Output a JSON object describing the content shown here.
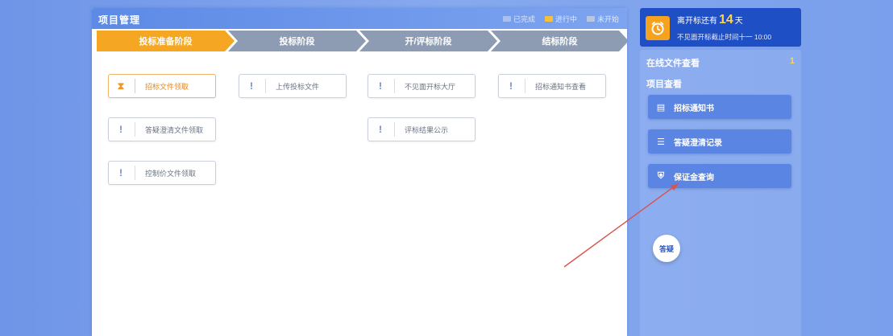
{
  "header": {
    "title": "项目管理",
    "legend": [
      {
        "label": "已完成",
        "color": "#a9c1f2"
      },
      {
        "label": "进行中",
        "color": "#f5c03a"
      },
      {
        "label": "未开始",
        "color": "#b9c6de"
      }
    ]
  },
  "steps": [
    {
      "label": "投标准备阶段",
      "state": "active"
    },
    {
      "label": "投标阶段",
      "state": "inactive"
    },
    {
      "label": "开/评标阶段",
      "state": "inactive"
    },
    {
      "label": "结标阶段",
      "state": "inactive"
    }
  ],
  "tasks": [
    {
      "label": "招标文件领取",
      "status": "done",
      "icon": "hourglass-icon",
      "glyph": "⧗"
    },
    {
      "label": "上传投标文件",
      "status": "pending",
      "icon": "exclamation-icon",
      "glyph": "!"
    },
    {
      "label": "不见面开标大厅",
      "status": "pending",
      "icon": "exclamation-icon",
      "glyph": "!"
    },
    {
      "label": "招标通知书查看",
      "status": "pending",
      "icon": "exclamation-icon",
      "glyph": "!"
    },
    {
      "label": "答疑澄清文件领取",
      "status": "pending",
      "icon": "exclamation-icon",
      "glyph": "!"
    },
    {
      "label": "评标结果公示",
      "status": "pending",
      "icon": "exclamation-icon",
      "glyph": "!"
    },
    {
      "label": "控制价文件领取",
      "status": "pending",
      "icon": "exclamation-icon",
      "glyph": "!"
    }
  ],
  "countdown": {
    "prefix": "离开标还有",
    "days": "14",
    "suffix": "天",
    "deadline": "不见面开标截止时间十一 10:00"
  },
  "sidebar": {
    "online_files_label": "在线文件查看",
    "online_files_count": "1",
    "project_view_label": "项目查看",
    "buttons": [
      {
        "label": "招标通知书",
        "icon": "document-icon",
        "glyph": "▤"
      },
      {
        "label": "答疑澄清记录",
        "icon": "record-icon",
        "glyph": "☰"
      },
      {
        "label": "保证金查询",
        "icon": "shield-icon",
        "glyph": "⛨"
      }
    ],
    "helper_label": "答疑"
  },
  "colors": {
    "accent": "#f5a623",
    "step_inactive": "#8d9bb3",
    "side_dark": "#1f4fc4",
    "annotation_arrow": "#d9534f"
  }
}
